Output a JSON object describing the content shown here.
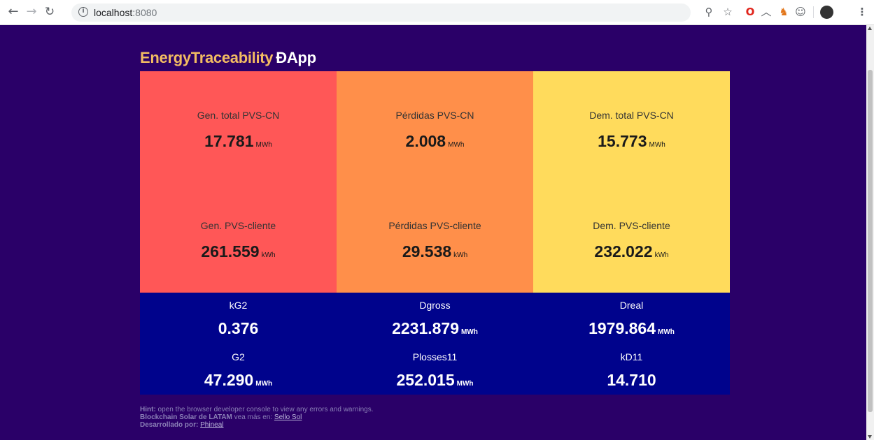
{
  "browser": {
    "url_host": "localhost",
    "url_port": ":8080"
  },
  "app": {
    "title": "EnergyTraceability",
    "title_suffix": "ÐApp"
  },
  "panels": [
    {
      "color": "#ff5757",
      "cards": [
        {
          "label": "Gen. total PVS-CN",
          "value": "17.781",
          "unit": "MWh"
        },
        {
          "label": "Gen. PVS-cliente",
          "value": "261.559",
          "unit": "kWh"
        }
      ]
    },
    {
      "color": "#ff8f4a",
      "cards": [
        {
          "label": "Pérdidas PVS-CN",
          "value": "2.008",
          "unit": "MWh"
        },
        {
          "label": "Pérdidas PVS-cliente",
          "value": "29.538",
          "unit": "kWh"
        }
      ]
    },
    {
      "color": "#ffdb5c",
      "cards": [
        {
          "label": "Dem. total PVS-CN",
          "value": "15.773",
          "unit": "MWh"
        },
        {
          "label": "Dem. PVS-cliente",
          "value": "232.022",
          "unit": "kWh"
        }
      ]
    }
  ],
  "metrics": [
    {
      "label": "kG2",
      "value": "0.376",
      "unit": ""
    },
    {
      "label": "Dgross",
      "value": "2231.879",
      "unit": "MWh"
    },
    {
      "label": "Dreal",
      "value": "1979.864",
      "unit": "MWh"
    },
    {
      "label": "G2",
      "value": "47.290",
      "unit": "MWh"
    },
    {
      "label": "Plosses11",
      "value": "252.015",
      "unit": "MWh"
    },
    {
      "label": "kD11",
      "value": "14.710",
      "unit": ""
    }
  ],
  "footer": {
    "hint_label": "Hint:",
    "hint_text": " open the browser developer console to view any errors and warnings.",
    "org": "Blockchain Solar de LATAM",
    "org_text": " vea más en: ",
    "org_link": "Sello Sol",
    "dev_label": "Desarrollado por:",
    "dev_link": "Phineal"
  },
  "colors": {
    "background": "#2a0068",
    "bottom_panel": "#00038c",
    "title": "#f2bb62"
  }
}
